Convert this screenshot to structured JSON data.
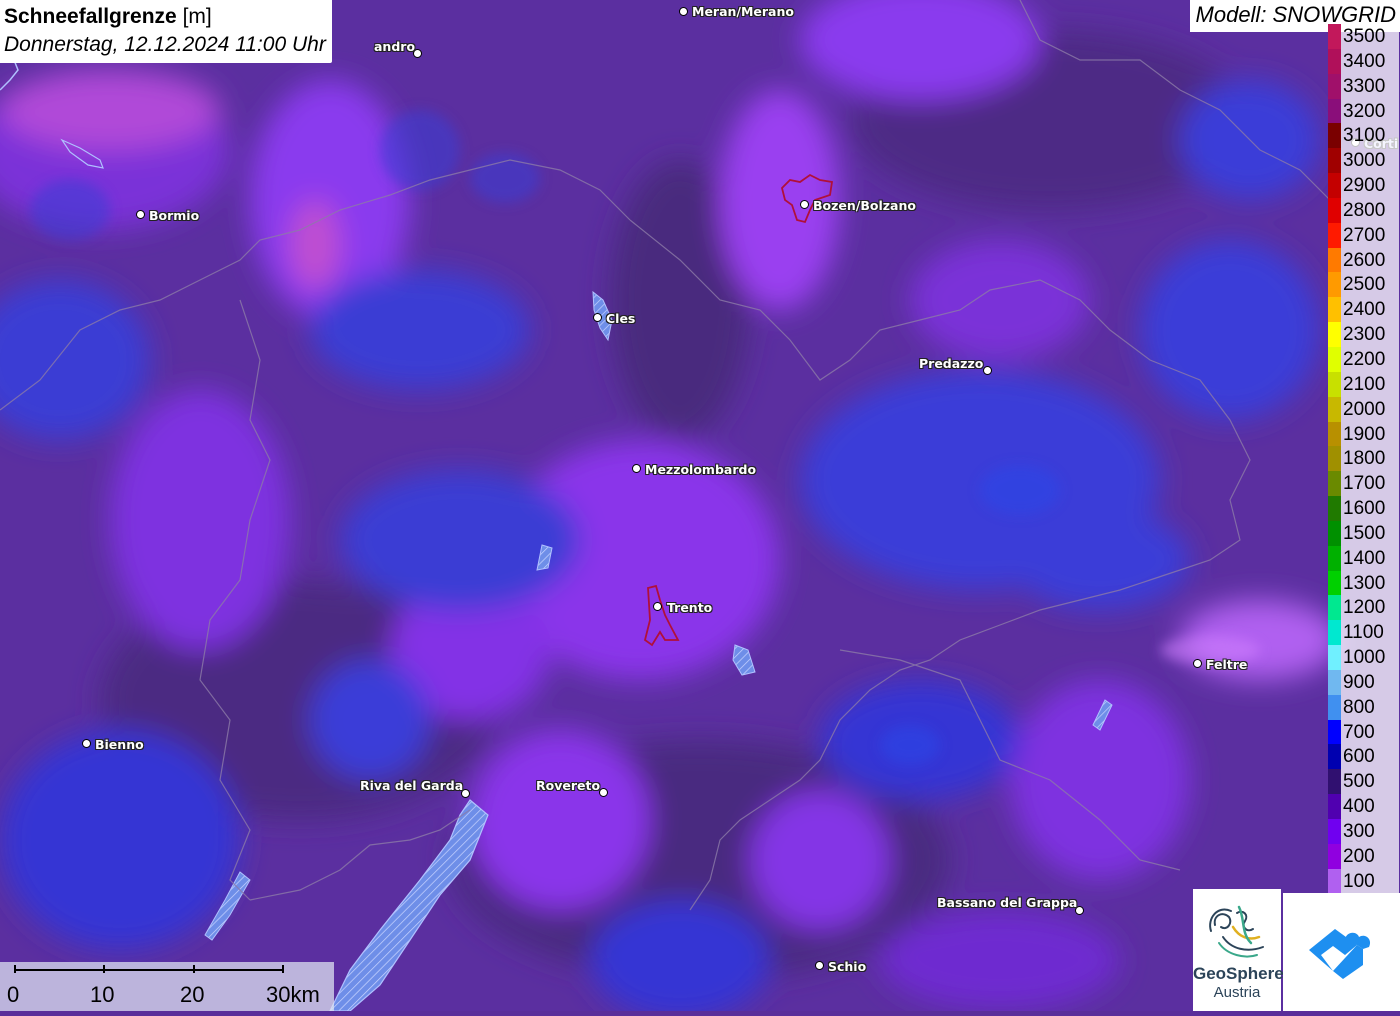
{
  "title": {
    "parameter": "Schneefallgrenze",
    "unit": "[m]",
    "datetime": "Donnerstag, 12.12.2024 11:00 Uhr"
  },
  "model_label": "Modell: SNOWGRID",
  "cities": [
    {
      "name": "Meran/Merano"
    },
    {
      "name": "andro"
    },
    {
      "name": "Bormio"
    },
    {
      "name": "Bozen/Bolzano"
    },
    {
      "name": "Cles"
    },
    {
      "name": "Predazzo"
    },
    {
      "name": "Mezzolombardo"
    },
    {
      "name": "Trento"
    },
    {
      "name": "Feltre"
    },
    {
      "name": "Bienno"
    },
    {
      "name": "Riva del Garda"
    },
    {
      "name": "Rovereto"
    },
    {
      "name": "Bassano del Grappa"
    },
    {
      "name": "Schio"
    },
    {
      "name": "Corti"
    }
  ],
  "legend": [
    {
      "label": "3500",
      "color": "#c2185b"
    },
    {
      "label": "3400",
      "color": "#b0105a"
    },
    {
      "label": "3300",
      "color": "#a0106a"
    },
    {
      "label": "3200",
      "color": "#8a0e7a"
    },
    {
      "label": "3100",
      "color": "#7a0000"
    },
    {
      "label": "3000",
      "color": "#a00000"
    },
    {
      "label": "2900",
      "color": "#c40000"
    },
    {
      "label": "2800",
      "color": "#e00000"
    },
    {
      "label": "2700",
      "color": "#ff1a00"
    },
    {
      "label": "2600",
      "color": "#ff7a00"
    },
    {
      "label": "2500",
      "color": "#ff9a00"
    },
    {
      "label": "2400",
      "color": "#ffc000"
    },
    {
      "label": "2300",
      "color": "#ffff00"
    },
    {
      "label": "2200",
      "color": "#e0ff00"
    },
    {
      "label": "2100",
      "color": "#c8e000"
    },
    {
      "label": "2000",
      "color": "#c8b800"
    },
    {
      "label": "1900",
      "color": "#b89000"
    },
    {
      "label": "1800",
      "color": "#a09000"
    },
    {
      "label": "1700",
      "color": "#6a8a00"
    },
    {
      "label": "1600",
      "color": "#207a00"
    },
    {
      "label": "1500",
      "color": "#009000"
    },
    {
      "label": "1400",
      "color": "#00b000"
    },
    {
      "label": "1300",
      "color": "#00d000"
    },
    {
      "label": "1200",
      "color": "#00e890"
    },
    {
      "label": "1100",
      "color": "#00e8d0"
    },
    {
      "label": "1000",
      "color": "#70f0ff"
    },
    {
      "label": "900",
      "color": "#70b8f0"
    },
    {
      "label": "800",
      "color": "#4090f0"
    },
    {
      "label": "700",
      "color": "#0000ff"
    },
    {
      "label": "600",
      "color": "#0000b0"
    },
    {
      "label": "500",
      "color": "#301070"
    },
    {
      "label": "400",
      "color": "#5000b0"
    },
    {
      "label": "300",
      "color": "#7000f0"
    },
    {
      "label": "200",
      "color": "#9000e0"
    },
    {
      "label": "100",
      "color": "#b060f0"
    }
  ],
  "scale": {
    "labels": [
      "0",
      "10",
      "20",
      "30km"
    ]
  },
  "logos": {
    "geosphere_line1": "GeoSphere",
    "geosphere_line2": "Austria"
  }
}
